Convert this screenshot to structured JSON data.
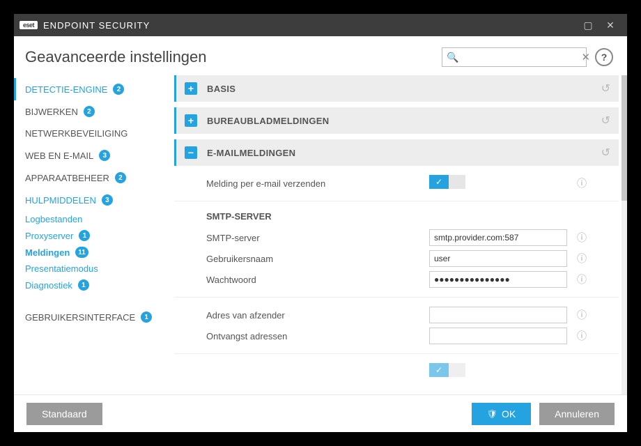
{
  "app": {
    "brand_badge": "eset",
    "brand_name": "ENDPOINT SECURITY"
  },
  "header": {
    "title": "Geavanceerde instellingen",
    "search_placeholder": ""
  },
  "sidebar": {
    "groups": [
      {
        "label": "DETECTIE-ENGINE",
        "badge": "2"
      },
      {
        "label": "BIJWERKEN",
        "badge": "2"
      },
      {
        "label": "NETWERKBEVEILIGING",
        "badge": ""
      },
      {
        "label": "WEB EN E-MAIL",
        "badge": "3"
      },
      {
        "label": "APPARAATBEHEER",
        "badge": "2"
      },
      {
        "label": "HULPMIDDELEN",
        "badge": "3"
      },
      {
        "label": "GEBRUIKERSINTERFACE",
        "badge": "1"
      }
    ],
    "subs": [
      {
        "label": "Logbestanden",
        "badge": ""
      },
      {
        "label": "Proxyserver",
        "badge": "1"
      },
      {
        "label": "Meldingen",
        "badge": "11"
      },
      {
        "label": "Presentatiemodus",
        "badge": ""
      },
      {
        "label": "Diagnostiek",
        "badge": "1"
      }
    ]
  },
  "sections": {
    "basis": {
      "title": "BASIS"
    },
    "desktop": {
      "title": "BUREAUBLADMELDINGEN"
    },
    "email": {
      "title": "E-MAILMELDINGEN",
      "send_label": "Melding per e-mail verzenden",
      "smtp_head": "SMTP-SERVER",
      "smtp_server_label": "SMTP-server",
      "smtp_server_value": "smtp.provider.com:587",
      "user_label": "Gebruikersnaam",
      "user_value": "user",
      "pass_label": "Wachtwoord",
      "pass_value": "●●●●●●●●●●●●●●●",
      "sender_label": "Adres van afzender",
      "sender_value": "",
      "recip_label": "Ontvangst adressen",
      "recip_value": ""
    }
  },
  "footer": {
    "default": "Standaard",
    "ok": "OK",
    "cancel": "Annuleren"
  }
}
